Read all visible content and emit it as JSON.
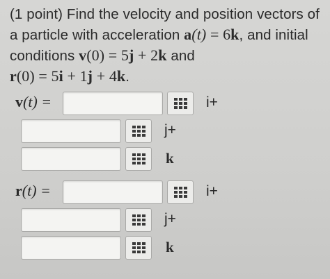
{
  "problem": {
    "prefix": "(1 point) Find the velocity and position vectors of a particle with acceleration ",
    "accel_lhs": "a",
    "accel_arg": "(t)",
    "accel_eq": " = 6",
    "accel_vec": "k",
    "mid1": ", and initial conditions ",
    "v0_lhs": "v",
    "v0_arg": "(0) = 5",
    "v0_j": "j",
    "v0_plus": " + 2",
    "v0_k": "k",
    "mid2": " and ",
    "r0_lhs": "r",
    "r0_arg": "(0) = 5",
    "r0_i": "i",
    "r0_p1": " + 1",
    "r0_j": "j",
    "r0_p2": " + 4",
    "r0_k": "k",
    "end": "."
  },
  "velocity": {
    "label_vec": "v",
    "label_arg": "(t) =",
    "components": [
      {
        "value": "",
        "unit": "i+"
      },
      {
        "value": "",
        "unit": "j+"
      },
      {
        "value": "",
        "unit": "k"
      }
    ]
  },
  "position": {
    "label_vec": "r",
    "label_arg": "(t) =",
    "components": [
      {
        "value": "",
        "unit": "i+"
      },
      {
        "value": "",
        "unit": "j+"
      },
      {
        "value": "",
        "unit": "k"
      }
    ]
  },
  "icons": {
    "matrix_button": "grid-icon"
  }
}
